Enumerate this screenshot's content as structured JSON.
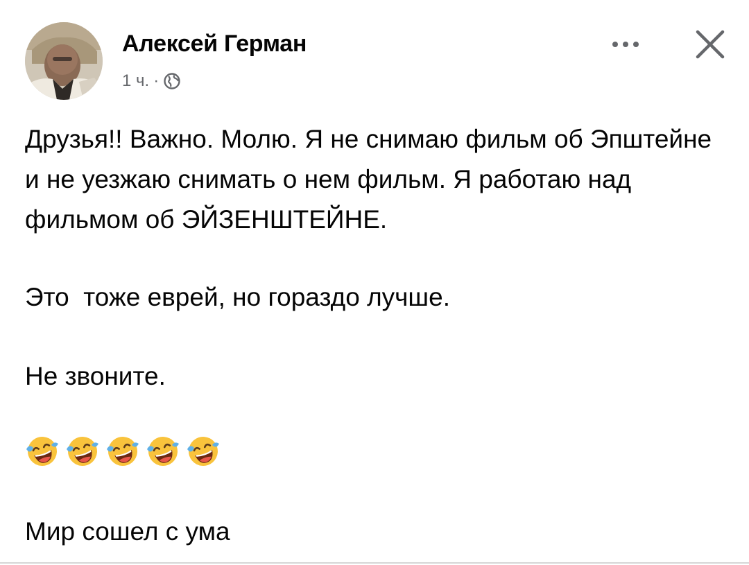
{
  "post": {
    "author": "Алексей Герман",
    "time": "1 ч.",
    "separator": "·",
    "privacy_icon": "globe-icon",
    "more_icon": "more-dots-icon",
    "close_icon": "close-icon",
    "paragraphs": [
      "Друзья!! Важно. Молю. Я не снимаю фильм об Эпштейне и не уезжаю снимать о нем фильм. Я работаю над фильмом об ЭЙЗЕНШТЕЙНЕ.",
      "Это  тоже еврей, но гораздо лучше.",
      "Не звоните.",
      "Мир сошел с ума"
    ],
    "emoji": "face-with-tears-of-joy-icon",
    "emoji_count": 5
  },
  "colors": {
    "text": "#050505",
    "secondary": "#65676b",
    "emoji_face": "#f9c33c",
    "tears": "#5fb0e8"
  }
}
